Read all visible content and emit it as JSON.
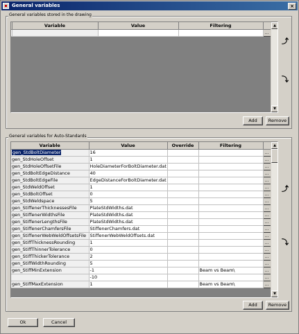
{
  "window": {
    "title": "General variables",
    "close_glyph": "×"
  },
  "drawing_group": {
    "label": "General variables stored in the drawing",
    "columns": [
      "Variable",
      "Value",
      "Filtering"
    ],
    "rows": [
      {
        "variable": "",
        "value": "",
        "filtering": ""
      }
    ],
    "add_label": "Add",
    "remove_label": "Remove"
  },
  "autostd_group": {
    "label": "General variables for Auto-Standards",
    "columns": [
      "Variable",
      "Value",
      "Override",
      "Filtering"
    ],
    "rows": [
      {
        "variable": "gen_StdBoltDiameter",
        "value": "16",
        "override": "",
        "filtering": ""
      },
      {
        "variable": "gen_StdHoleOffset",
        "value": "1",
        "override": "",
        "filtering": ""
      },
      {
        "variable": "gen_StdHoleOffsetFile",
        "value": "HoleDiameterForBoltDiameter.dat",
        "override": "",
        "filtering": ""
      },
      {
        "variable": "gen_StdBoltEdgeDistance",
        "value": "40",
        "override": "",
        "filtering": ""
      },
      {
        "variable": "gen_StdBoltEdgeFile",
        "value": "EdgeDistanceForBoltDiameter.dat",
        "override": "",
        "filtering": ""
      },
      {
        "variable": "gen_StdWeldOffset",
        "value": "1",
        "override": "",
        "filtering": ""
      },
      {
        "variable": "gen_StdBoltOffset",
        "value": "0",
        "override": "",
        "filtering": ""
      },
      {
        "variable": "gen_StdWeldspace",
        "value": "5",
        "override": "",
        "filtering": ""
      },
      {
        "variable": "gen_StiffenerThicknessesFile",
        "value": "PlateStdWidths.dat",
        "override": "",
        "filtering": ""
      },
      {
        "variable": "gen_StiffenerWidthsFile",
        "value": "PlateStdWidths.dat",
        "override": "",
        "filtering": ""
      },
      {
        "variable": "gen_StiffenerLengthsFile",
        "value": "PlateStdWidths.dat",
        "override": "",
        "filtering": ""
      },
      {
        "variable": "gen_StiffenerChamfersFile",
        "value": "StiffenerChamfers.dat",
        "override": "",
        "filtering": ""
      },
      {
        "variable": "gen_StiffenerWebWeldOffsetsFile",
        "value": "StiffenerWebWeldOffsets.dat",
        "override": "",
        "filtering": ""
      },
      {
        "variable": "gen_StiffThicknessRounding",
        "value": "1",
        "override": "",
        "filtering": ""
      },
      {
        "variable": "gen_StiffThinnerTolerance",
        "value": "0",
        "override": "",
        "filtering": ""
      },
      {
        "variable": "gen_StiffThickerTolerance",
        "value": "2",
        "override": "",
        "filtering": ""
      },
      {
        "variable": "gen_StiffWidthRounding",
        "value": "5",
        "override": "",
        "filtering": ""
      },
      {
        "variable": "gen_StiffMinExtension",
        "value": "-1",
        "override": "",
        "filtering": "Beam vs Beam\\"
      },
      {
        "variable": "",
        "value": "-10",
        "override": "",
        "filtering": ""
      },
      {
        "variable": "gen_StiffMaxExtension",
        "value": "1",
        "override": "",
        "filtering": "Beam vs Beam\\"
      }
    ],
    "add_label": "Add",
    "remove_label": "Remove"
  },
  "footer": {
    "ok_label": "Ok",
    "cancel_label": "Cancel"
  },
  "icons": {
    "ellipsis": "...",
    "scroll_up": "▲",
    "scroll_down": "▼",
    "move_up": "⤴",
    "move_down": "⤵"
  }
}
